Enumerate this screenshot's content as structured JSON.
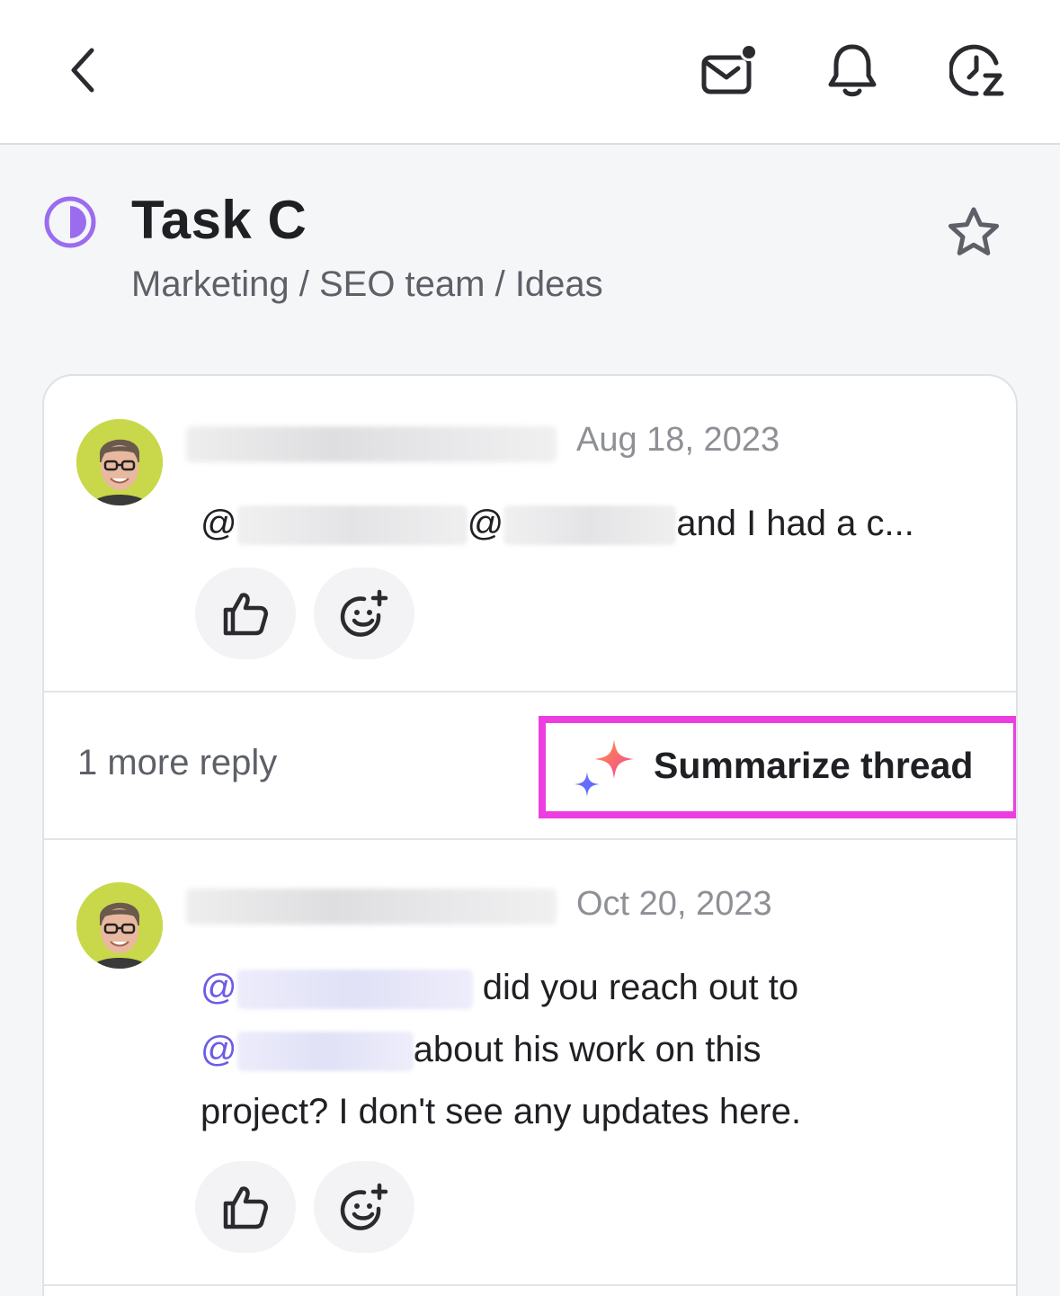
{
  "header": {
    "back_icon": "chevron-left-icon",
    "inbox_icon": "mail-unread-icon",
    "notifications_icon": "bell-icon",
    "reminders_icon": "clock-snooze-icon"
  },
  "task": {
    "status_icon": "half-circle-status-icon",
    "status_color": "#9b6cf0",
    "title": "Task C",
    "breadcrumb": "Marketing / SEO team / Ideas",
    "favorite_icon": "star-outline-icon"
  },
  "comments": [
    {
      "date": "Aug 18, 2023",
      "at1": "@",
      "at2": "@",
      "text_tail": "and I had a c..."
    },
    {
      "date": "Oct 20, 2023",
      "at1": "@",
      "text_after_1": " did you reach out to",
      "at2": "@",
      "text_after_2": "about his work on this",
      "line3": "project? I don't see any updates here."
    }
  ],
  "thread": {
    "more_replies": "1 more reply",
    "summarize_label": "Summarize thread",
    "highlight_color": "#ec3ee0"
  },
  "reactions": {
    "like_icon": "thumbs-up-icon",
    "add_reaction_icon": "add-emoji-icon"
  }
}
